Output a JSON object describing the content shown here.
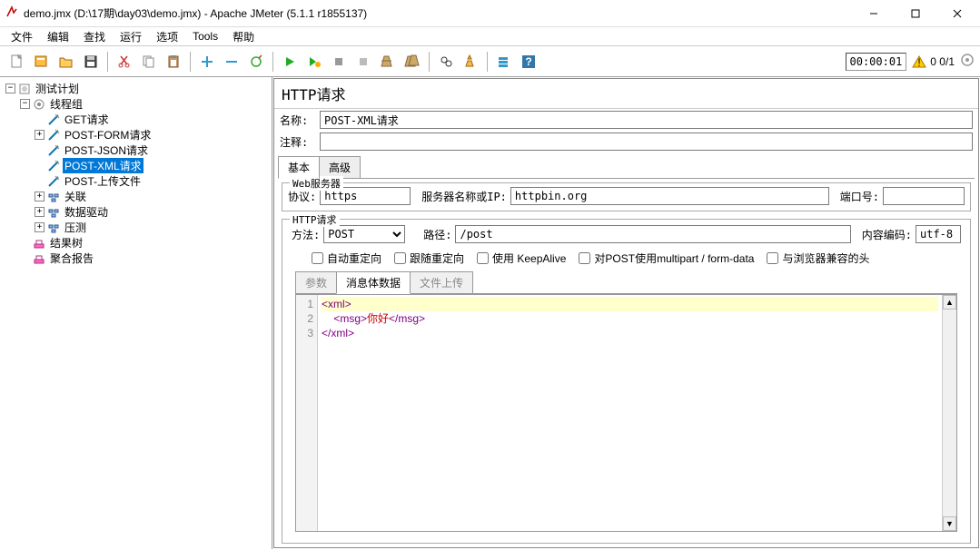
{
  "window": {
    "title": "demo.jmx (D:\\17期\\day03\\demo.jmx) - Apache JMeter (5.1.1 r1855137)"
  },
  "menu": {
    "file": "文件",
    "edit": "编辑",
    "search": "查找",
    "run": "运行",
    "options": "选项",
    "tools": "Tools",
    "help": "帮助"
  },
  "toolbar_right": {
    "timer": "00:00:01",
    "errcount": "0  0/1"
  },
  "tree": {
    "root": "测试计划",
    "threadgroup": "线程组",
    "items": [
      "GET请求",
      "POST-FORM请求",
      "POST-JSON请求",
      "POST-XML请求",
      "POST-上传文件",
      "关联",
      "数据驱动",
      "压测"
    ],
    "resultTree": "结果树",
    "aggregate": "聚合报告"
  },
  "panel": {
    "title": "HTTP请求",
    "nameLabel": "名称:",
    "nameValue": "POST-XML请求",
    "commentsLabel": "注释:",
    "commentsValue": "",
    "tabBasic": "基本",
    "tabAdvanced": "高级",
    "webserver": {
      "legend": "Web服务器",
      "protocolLabel": "协议:",
      "protocolValue": "https",
      "serverLabel": "服务器名称或IP:",
      "serverValue": "httpbin.org",
      "portLabel": "端口号:",
      "portValue": ""
    },
    "httpreq": {
      "legend": "HTTP请求",
      "methodLabel": "方法:",
      "methodValue": "POST",
      "pathLabel": "路径:",
      "pathValue": "/post",
      "encodingLabel": "内容编码:",
      "encodingValue": "utf-8",
      "cbRedirect": "自动重定向",
      "cbFollow": "跟随重定向",
      "cbKeepAlive": "使用 KeepAlive",
      "cbMultipart": "对POST使用multipart / form-data",
      "cbBrowser": "与浏览器兼容的头"
    },
    "bodytabs": {
      "params": "参数",
      "body": "消息体数据",
      "files": "文件上传"
    },
    "code": {
      "l1": "<xml>",
      "l2pre": "    <msg>",
      "l2txt": "你好",
      "l2post": "</msg>",
      "l3": "</xml>",
      "ln1": "1",
      "ln2": "2",
      "ln3": "3"
    }
  }
}
